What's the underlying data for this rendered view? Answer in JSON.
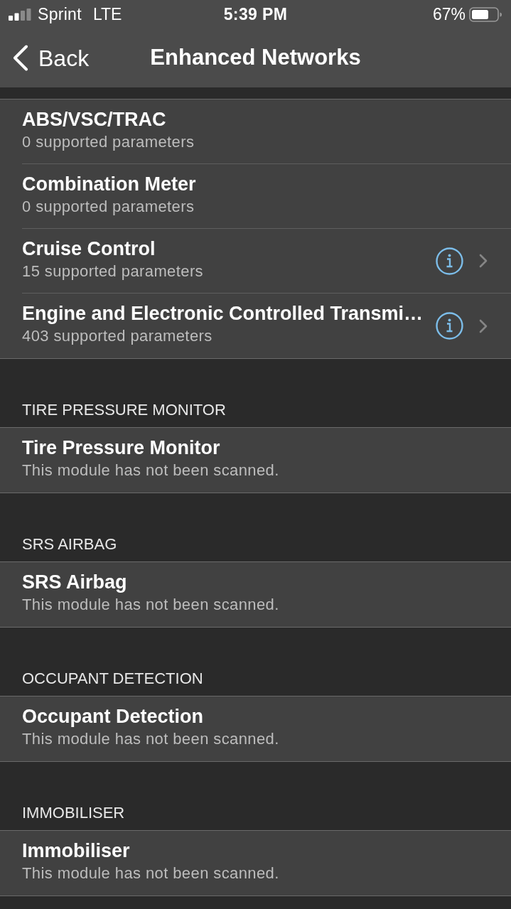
{
  "status_bar": {
    "carrier": "Sprint",
    "network": "LTE",
    "time": "5:39 PM",
    "battery": "67%"
  },
  "nav_bar": {
    "back": "Back",
    "title": "Enhanced Networks"
  },
  "sections": [
    {
      "rows": [
        {
          "kind": "plain",
          "title": "ABS/VSC/TRAC",
          "subtitle": "0 supported parameters"
        },
        {
          "kind": "plain",
          "title": "Combination Meter",
          "subtitle": "0 supported parameters"
        },
        {
          "kind": "detail",
          "title": "Cruise Control",
          "subtitle": "15 supported parameters"
        },
        {
          "kind": "detail",
          "title": "Engine and Electronic Controlled Transmi…",
          "subtitle": "403 supported parameters"
        }
      ]
    },
    {
      "header": "TIRE PRESSURE MONITOR",
      "rows": [
        {
          "kind": "plain",
          "title": "Tire Pressure Monitor",
          "subtitle": "This module has not been scanned."
        }
      ]
    },
    {
      "header": "SRS AIRBAG",
      "rows": [
        {
          "kind": "plain",
          "title": "SRS Airbag",
          "subtitle": "This module has not been scanned."
        }
      ]
    },
    {
      "header": "OCCUPANT DETECTION",
      "rows": [
        {
          "kind": "plain",
          "title": "Occupant Detection",
          "subtitle": "This module has not been scanned."
        }
      ]
    },
    {
      "header": "IMMOBILISER",
      "rows": [
        {
          "kind": "plain",
          "title": "Immobiliser",
          "subtitle": "This module has not been scanned."
        }
      ]
    }
  ]
}
